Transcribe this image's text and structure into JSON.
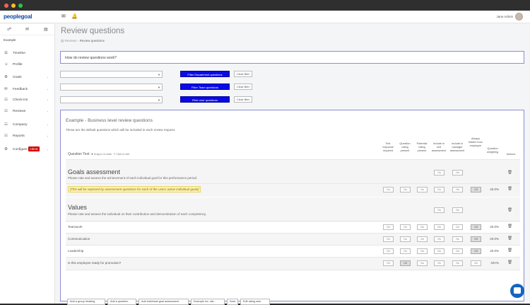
{
  "window": {
    "dots": [
      "#ff5f57",
      "#febc2e",
      "#28c840"
    ]
  },
  "topbar": {
    "logo_a": "people",
    "logo_b": "goal",
    "user_name": "Jane Admin"
  },
  "sidebar": {
    "section_label": "Example",
    "items": [
      {
        "label": "Timeline",
        "icon": "timeline-icon",
        "glyph": "☰"
      },
      {
        "label": "Profile",
        "icon": "user-icon",
        "glyph": "☺"
      },
      {
        "label": "Goals",
        "icon": "goals-icon",
        "glyph": "⚙"
      },
      {
        "label": "Feedback",
        "icon": "comment-icon",
        "glyph": "✉"
      },
      {
        "label": "Check-ins",
        "icon": "chat-icon",
        "glyph": "☷"
      },
      {
        "label": "Reviews",
        "icon": "document-icon",
        "glyph": "☷"
      },
      {
        "label": "Company",
        "icon": "org-icon",
        "glyph": "☷"
      },
      {
        "label": "Reports",
        "icon": "chart-icon",
        "glyph": "☷"
      },
      {
        "label": "Configure",
        "icon": "gear-icon",
        "glyph": "⚙",
        "badge": "Admin"
      }
    ]
  },
  "page": {
    "title": "Review questions",
    "breadcrumb_parent": "Reviews",
    "breadcrumb_current": "Review questions",
    "how_it_works": "How do review questions work?"
  },
  "filters": [
    {
      "button": "Filter Department questions",
      "clear": "Clear filter"
    },
    {
      "button": "Filter Team questions",
      "clear": "Clear filter"
    },
    {
      "button": "Filter user questions",
      "clear": "Clear filter"
    }
  ],
  "panel": {
    "title": "Example - Business level review questions",
    "subtitle": "These are the default questions which will be included in each review request.",
    "question_text_header": "Question Text",
    "drag_hint": "Drag to re-order",
    "click_hint": "Click to edit",
    "columns": [
      "Text response required",
      "Question rating present",
      "Potential rating present",
      "Include in self assessment",
      "Include in manager assessment",
      "Always hidden from employee",
      "Question weighting",
      "Actions"
    ],
    "groups": [
      {
        "name": "Goals assessment",
        "description": "Please rate and assess the achievement of each individual goal for this performance period.",
        "toggles": [
          "On",
          "On"
        ],
        "rows": [
          {
            "text": "[This will be replaced by assessment questions for each of the users active individual goals]",
            "highlight": true,
            "toggles": [
              "On",
              "On",
              "On",
              "On",
              "On",
              "Off"
            ],
            "weight": "40.0%"
          }
        ]
      },
      {
        "name": "Values",
        "description": "Please rate and assess the individual on their contribution and demonstration of each competency.",
        "toggles": [
          "On",
          "On"
        ],
        "rows": [
          {
            "text": "Teamwork",
            "highlight": false,
            "toggles": [
              "On",
              "On",
              "On",
              "On",
              "On",
              "Off"
            ],
            "weight": "20.0%"
          },
          {
            "text": "Communication",
            "highlight": false,
            "toggles": [
              "On",
              "On",
              "On",
              "On",
              "On",
              "Off"
            ],
            "weight": "20.0%"
          },
          {
            "text": "Leadership",
            "highlight": false,
            "toggles": [
              "On",
              "On",
              "On",
              "On",
              "On",
              "Off"
            ],
            "weight": "20.0%"
          },
          {
            "text": "Is this employee ready for promotion?",
            "highlight": false,
            "toggles": [
              "On",
              "Off",
              "On",
              "On",
              "On",
              "On"
            ],
            "weight": "N/A%"
          }
        ]
      }
    ],
    "footer_buttons": [
      "Add a group heading",
      "Add a question",
      "Add individual goal assessment",
      "Example Inc. rati...",
      "Save",
      "Edit rating sets"
    ]
  }
}
